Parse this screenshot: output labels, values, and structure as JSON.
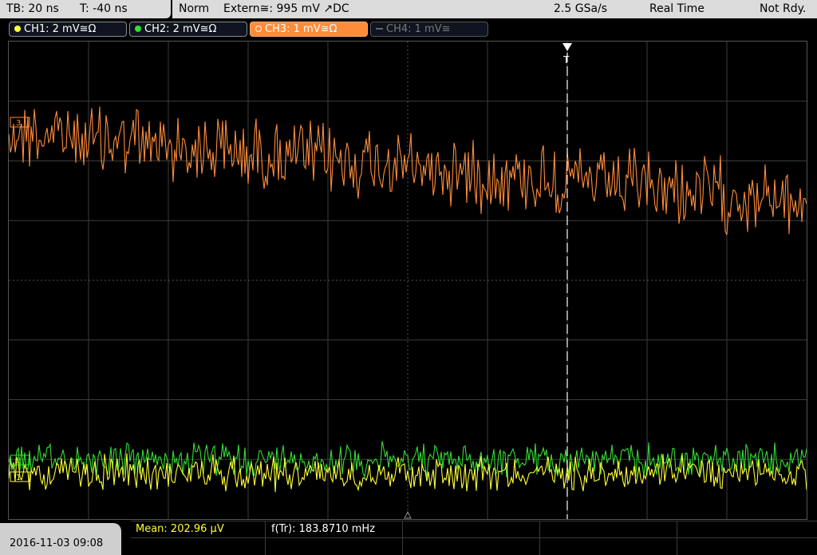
{
  "timebase": {
    "tb_label": "TB: 20 ns",
    "trigger_offset_label": "T: -40 ns"
  },
  "status": {
    "mode": "Norm",
    "trigger": "Extern≅: 995 mV ↗DC",
    "sample_rate": "2.5 GSa/s",
    "acq_mode": "Real Time",
    "state": "Not Rdy."
  },
  "channels": [
    {
      "label": "CH1: 2 mV≅Ω",
      "color": "#ffff33",
      "active": true
    },
    {
      "label": "CH2: 2 mV≅Ω",
      "color": "#33dd33",
      "active": true
    },
    {
      "label": "CH3: 1 mV≅Ω",
      "color": "#ff8c3a",
      "active": true,
      "selected": true
    },
    {
      "label": "CH4: 1 mV≅",
      "color": "#777777",
      "active": false
    }
  ],
  "trigger_marker": "T",
  "ref_markers": {
    "ch3": "3",
    "ch2": "2",
    "ch1": "1"
  },
  "footer": {
    "datetime": "2016-11-03 09:08",
    "measurement_1": "Mean: 202.96 µV",
    "measurement_2": "f(Tr): 183.8710 mHz"
  },
  "colors": {
    "ch1": "#ffff33",
    "ch2": "#33dd33",
    "ch3": "#ff8c3a",
    "grid": "#3c3c3c"
  }
}
